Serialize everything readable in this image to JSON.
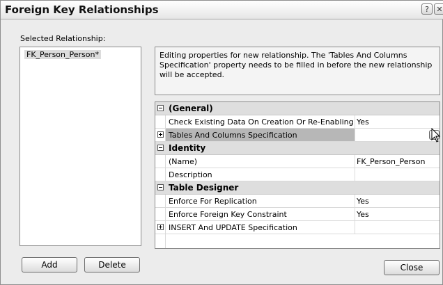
{
  "window": {
    "title": "Foreign Key Relationships",
    "help_glyph": "?",
    "close_glyph": "✕"
  },
  "relationships": {
    "label": "Selected Relationship:",
    "items": [
      "FK_Person_Person*"
    ]
  },
  "info": {
    "text": "Editing properties for new relationship.  The 'Tables And Columns Specification' property needs to be filled in before the new relationship will be accepted."
  },
  "grid": {
    "categories": [
      {
        "name": "(General)"
      },
      {
        "name": "Identity"
      },
      {
        "name": "Table Designer"
      }
    ],
    "props": [
      {
        "name": "Check Existing Data On Creation Or Re-Enabling",
        "value": "Yes"
      },
      {
        "name": "Tables And Columns Specification",
        "value": "",
        "button": "..."
      },
      {
        "name": "(Name)",
        "value": "FK_Person_Person"
      },
      {
        "name": "Description",
        "value": ""
      },
      {
        "name": "Enforce For Replication",
        "value": "Yes"
      },
      {
        "name": "Enforce Foreign Key Constraint",
        "value": "Yes"
      },
      {
        "name": "INSERT And UPDATE Specification",
        "value": ""
      }
    ]
  },
  "buttons": {
    "add": "Add",
    "delete": "Delete",
    "close": "Close"
  }
}
